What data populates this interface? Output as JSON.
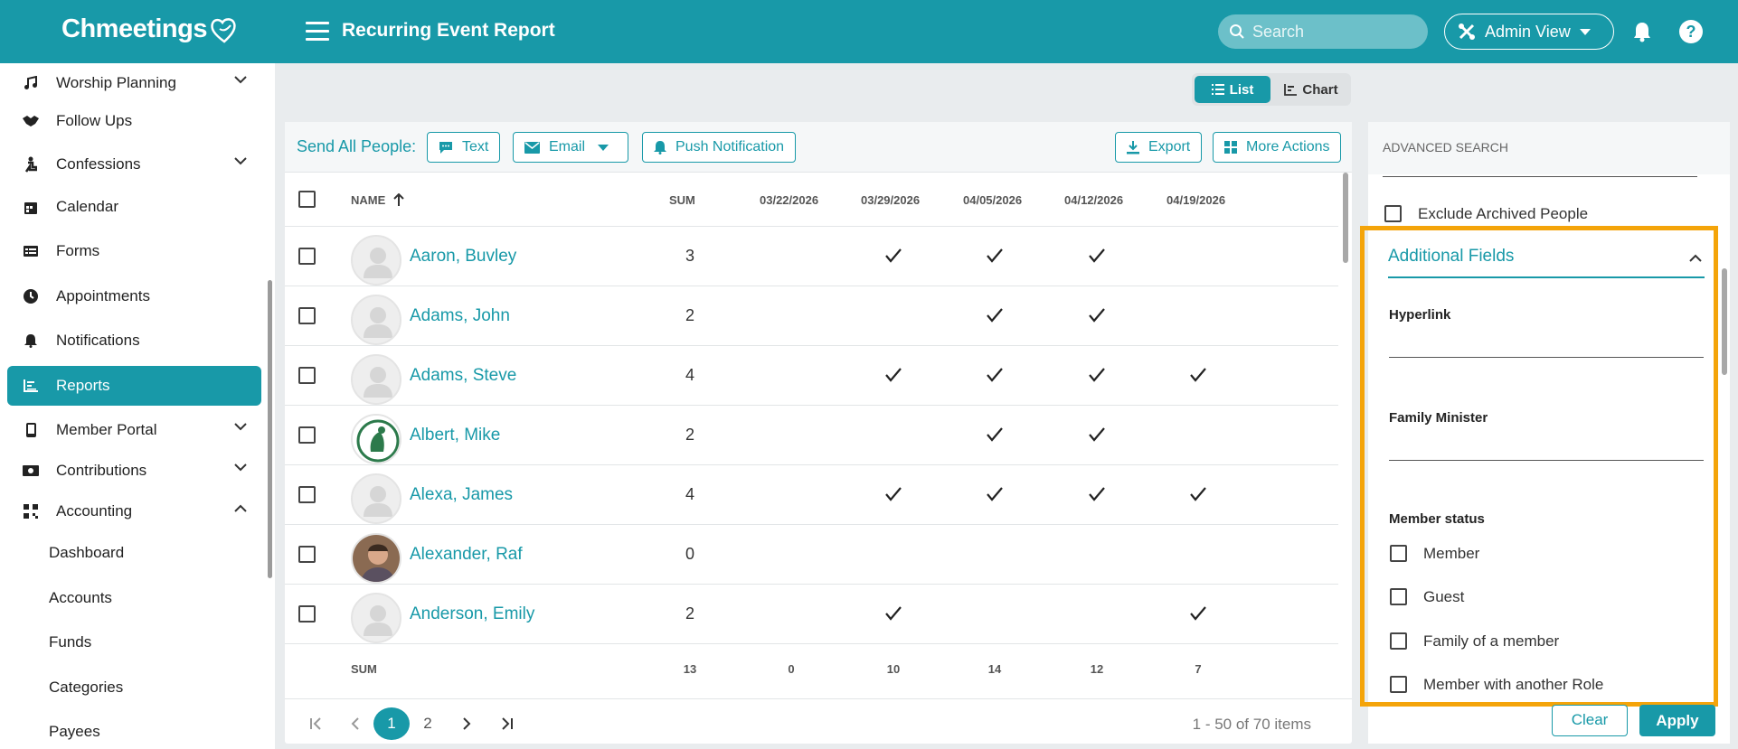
{
  "header": {
    "logo": "Chmeetings",
    "title": "Recurring Event Report",
    "search_placeholder": "Search",
    "admin_view": "Admin View",
    "help": "?"
  },
  "sidebar": {
    "items": [
      {
        "label": "Worship Planning",
        "icon": "music-note-icon",
        "chevron": "down"
      },
      {
        "label": "Follow Ups",
        "icon": "handshake-icon"
      },
      {
        "label": "Confessions",
        "icon": "kneel-icon",
        "chevron": "down"
      },
      {
        "label": "Calendar",
        "icon": "calendar-icon"
      },
      {
        "label": "Forms",
        "icon": "form-icon"
      },
      {
        "label": "Appointments",
        "icon": "clock-icon"
      },
      {
        "label": "Notifications",
        "icon": "bell-icon"
      },
      {
        "label": "Reports",
        "icon": "chart-icon",
        "active": true
      },
      {
        "label": "Member Portal",
        "icon": "mobile-icon",
        "chevron": "down"
      },
      {
        "label": "Contributions",
        "icon": "money-icon",
        "chevron": "down"
      },
      {
        "label": "Accounting",
        "icon": "qr-icon",
        "chevron": "up"
      }
    ],
    "sub_items": [
      "Dashboard",
      "Accounts",
      "Funds",
      "Categories",
      "Payees"
    ]
  },
  "view_toggle": {
    "list": "List",
    "chart": "Chart",
    "selected": "List"
  },
  "actions": {
    "send_label": "Send All People:",
    "text": "Text",
    "email": "Email",
    "push": "Push Notification",
    "export": "Export",
    "more": "More Actions"
  },
  "table": {
    "headers": {
      "name": "NAME",
      "sum": "SUM",
      "dates": [
        "03/22/2026",
        "03/29/2026",
        "04/05/2026",
        "04/12/2026",
        "04/19/2026"
      ]
    },
    "rows": [
      {
        "name": "Aaron, Buvley",
        "sum": "3",
        "att": [
          false,
          true,
          true,
          true,
          false
        ],
        "avatar": "placeholder"
      },
      {
        "name": "Adams, John",
        "sum": "2",
        "att": [
          false,
          false,
          true,
          true,
          false
        ],
        "avatar": "placeholder"
      },
      {
        "name": "Adams, Steve",
        "sum": "4",
        "att": [
          false,
          true,
          true,
          true,
          true
        ],
        "avatar": "placeholder"
      },
      {
        "name": "Albert, Mike",
        "sum": "2",
        "att": [
          false,
          false,
          true,
          true,
          false
        ],
        "avatar": "logo"
      },
      {
        "name": "Alexa, James",
        "sum": "4",
        "att": [
          false,
          true,
          true,
          true,
          true
        ],
        "avatar": "placeholder"
      },
      {
        "name": "Alexander, Raf",
        "sum": "0",
        "att": [
          false,
          false,
          false,
          false,
          false
        ],
        "avatar": "photo"
      },
      {
        "name": "Anderson, Emily",
        "sum": "2",
        "att": [
          false,
          true,
          false,
          false,
          true
        ],
        "avatar": "placeholder"
      }
    ],
    "footer": {
      "label": "SUM",
      "sum": "13",
      "dates": [
        "0",
        "10",
        "14",
        "12",
        "7"
      ]
    }
  },
  "pagination": {
    "pages": [
      "1",
      "2"
    ],
    "current": "1",
    "info": "1 - 50 of 70 items"
  },
  "advanced": {
    "title": "ADVANCED SEARCH",
    "exclude_archived": "Exclude Archived People",
    "additional_fields": "Additional Fields",
    "hyperlink": "Hyperlink",
    "family_minister": "Family Minister",
    "member_status": "Member status",
    "status_options": [
      "Member",
      "Guest",
      "Family of a member",
      "Member with another Role"
    ],
    "clear": "Clear",
    "apply": "Apply"
  },
  "colors": {
    "accent": "#1899a8",
    "highlight": "#f4a40a"
  }
}
